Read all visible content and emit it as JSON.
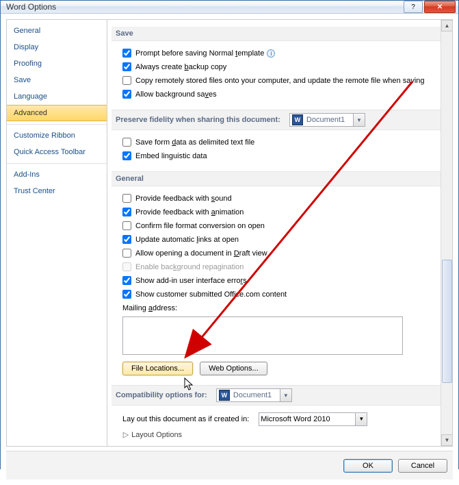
{
  "window": {
    "title": "Word Options"
  },
  "title_buttons": {
    "help": "?",
    "close": "✕"
  },
  "nav": {
    "items": [
      {
        "label": "General"
      },
      {
        "label": "Display"
      },
      {
        "label": "Proofing"
      },
      {
        "label": "Save"
      },
      {
        "label": "Language"
      },
      {
        "label": "Advanced",
        "selected": true
      },
      {
        "label": "Customize Ribbon"
      },
      {
        "label": "Quick Access Toolbar"
      },
      {
        "label": "Add-Ins"
      },
      {
        "label": "Trust Center"
      }
    ]
  },
  "save": {
    "heading": "Save",
    "prompt_normal": {
      "checked": true,
      "pre": "Prompt before saving Normal ",
      "u": "t",
      "post": "emplate"
    },
    "backup": {
      "checked": true,
      "pre": "Always create ",
      "u": "b",
      "post": "ackup copy"
    },
    "copy_remote": {
      "checked": false,
      "text": "Copy remotely stored files onto your computer, and update the remote file when saving"
    },
    "bg_saves": {
      "checked": true,
      "pre": "Allow background sa",
      "u": "v",
      "post": "es"
    }
  },
  "preserve": {
    "heading": "Preserve fidelity when sharing this document:",
    "doc": "Document1",
    "save_form": {
      "checked": false,
      "pre": "Save form ",
      "u": "d",
      "post": "ata as delimited text file"
    },
    "embed_ling": {
      "checked": true,
      "text": "Embed linguistic data"
    }
  },
  "general": {
    "heading": "General",
    "sound": {
      "checked": false,
      "pre": "Provide feedback with ",
      "u": "s",
      "post": "ound"
    },
    "anim": {
      "checked": true,
      "pre": "Provide feedback with ",
      "u": "a",
      "post": "nimation"
    },
    "confirm": {
      "checked": false,
      "text": "Confirm file format conversion on open"
    },
    "update_links": {
      "checked": true,
      "pre": "Update automatic ",
      "u": "l",
      "post": "inks at open"
    },
    "draft": {
      "checked": false,
      "pre": "Allow opening a document in ",
      "u": "D",
      "post": "raft view"
    },
    "repag": {
      "checked": false,
      "disabled": true,
      "pre": "Enable bac",
      "u": "k",
      "post": "ground repagination"
    },
    "addin_err": {
      "checked": true,
      "pre": "Show add-in user interface erro",
      "u": "r",
      "post": "s"
    },
    "office_content": {
      "checked": true,
      "text": "Show customer submitted Office.com content"
    },
    "mailing_label": "Mailing address:",
    "mailing_u": "a",
    "file_locations_btn": "File Locations...",
    "web_options_btn": "Web Options..."
  },
  "compat": {
    "heading": "Compatibility options for:",
    "doc": "Document1",
    "layout_label": "Lay out this document as if created in:",
    "layout_value": "Microsoft Word 2010",
    "layout_options": "Layout Options",
    "layout_u": "L"
  },
  "footer": {
    "ok": "OK",
    "cancel": "Cancel"
  }
}
